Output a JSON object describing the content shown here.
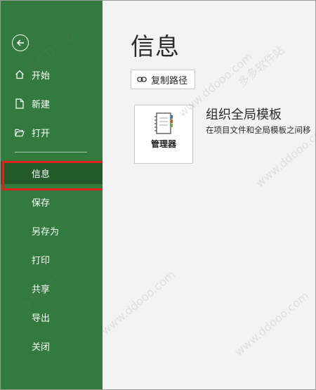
{
  "sidebar": {
    "items": [
      {
        "label": "开始",
        "icon": "home-icon"
      },
      {
        "label": "新建",
        "icon": "new-document-icon"
      },
      {
        "label": "打开",
        "icon": "open-folder-icon"
      },
      {
        "label": "信息",
        "active": true
      },
      {
        "label": "保存"
      },
      {
        "label": "另存为"
      },
      {
        "label": "打印"
      },
      {
        "label": "共享"
      },
      {
        "label": "导出"
      },
      {
        "label": "关闭"
      }
    ]
  },
  "main": {
    "title": "信息",
    "copy_path_label": "复制路径",
    "tile_label": "管理器",
    "section_title": "组织全局模板",
    "section_desc": "在项目文件和全局模板之间移"
  },
  "watermark": {
    "cn": "多多软件站",
    "url": "www.ddooo.com"
  },
  "colors": {
    "sidebar": "#337a3e",
    "sidebar_active": "#225a2a",
    "highlight": "#e0211f"
  }
}
